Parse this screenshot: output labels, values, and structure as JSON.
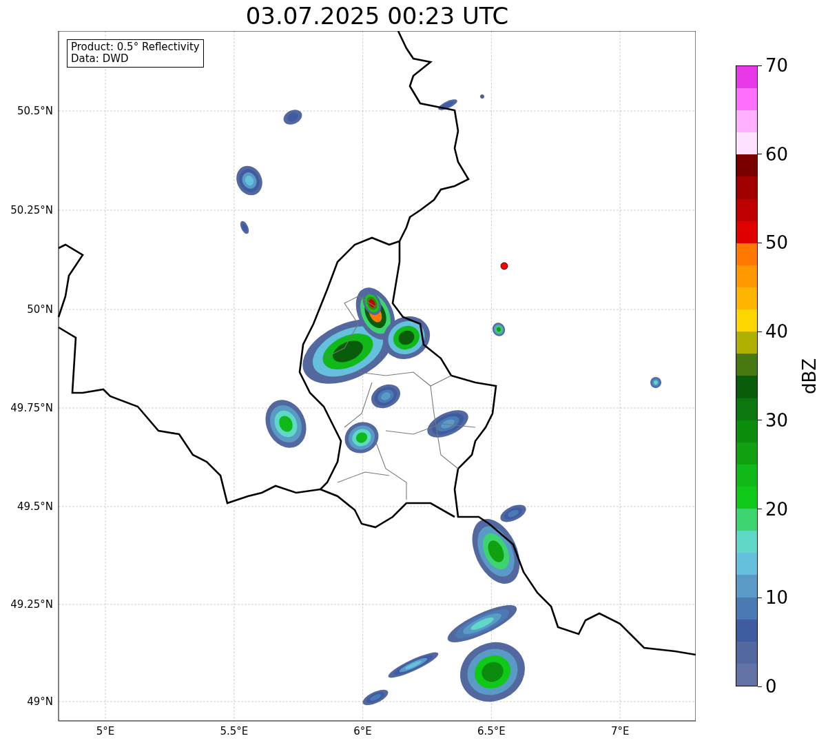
{
  "title": "03.07.2025 00:23 UTC",
  "legend": {
    "lines": [
      "Product: 0.5° Reflectivity",
      "Data: DWD"
    ]
  },
  "map": {
    "longitude_ticks": [
      "5°E",
      "5.5°E",
      "6°E",
      "6.5°E",
      "7°E"
    ],
    "latitude_ticks": [
      "50.5°N",
      "50.25°N",
      "50°N",
      "49.75°N",
      "49.5°N",
      "49.25°N",
      "49°N"
    ]
  },
  "colorbar": {
    "label": "dBZ",
    "ticks": [
      "70",
      "60",
      "50",
      "40",
      "30",
      "20",
      "10",
      "0"
    ],
    "segments": [
      {
        "color": "#6473a5"
      },
      {
        "color": "#53689f"
      },
      {
        "color": "#405ca0"
      },
      {
        "color": "#4a7ab4"
      },
      {
        "color": "#5a9ac6"
      },
      {
        "color": "#64c0dc"
      },
      {
        "color": "#60d8c8"
      },
      {
        "color": "#3cd46e"
      },
      {
        "color": "#10c818"
      },
      {
        "color": "#10b818"
      },
      {
        "color": "#10a010"
      },
      {
        "color": "#0c8c0c"
      },
      {
        "color": "#0a780e"
      },
      {
        "color": "#085c0a"
      },
      {
        "color": "#487810"
      },
      {
        "color": "#b0b000"
      },
      {
        "color": "#ffd700"
      },
      {
        "color": "#ffb400"
      },
      {
        "color": "#ff9800"
      },
      {
        "color": "#ff7800"
      },
      {
        "color": "#e00000"
      },
      {
        "color": "#c00000"
      },
      {
        "color": "#a00000"
      },
      {
        "color": "#780000"
      },
      {
        "color": "#ffe0ff"
      },
      {
        "color": "#ffb0ff"
      },
      {
        "color": "#ff70ff"
      },
      {
        "color": "#e838e8"
      }
    ]
  }
}
